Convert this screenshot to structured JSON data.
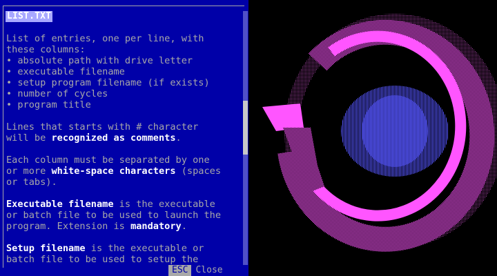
{
  "window": {
    "title": "LIST.TXT"
  },
  "help_lines": [
    [
      {
        "t": "List of entries, one per line, with"
      }
    ],
    [
      {
        "t": "these columns:"
      }
    ],
    [
      {
        "t": "• absolute path with drive letter"
      }
    ],
    [
      {
        "t": "• executable filename"
      }
    ],
    [
      {
        "t": "• setup program filename (if exists)"
      }
    ],
    [
      {
        "t": "• number of cycles"
      }
    ],
    [
      {
        "t": "• program title"
      }
    ],
    [
      {
        "t": ""
      }
    ],
    [
      {
        "t": "Lines that starts with # character"
      }
    ],
    [
      {
        "t": "will be "
      },
      {
        "t": "recognized as comments",
        "h": true
      },
      {
        "t": "."
      }
    ],
    [
      {
        "t": ""
      }
    ],
    [
      {
        "t": "Each column must be separated by one"
      }
    ],
    [
      {
        "t": "or more "
      },
      {
        "t": "white-space characters",
        "h": true
      },
      {
        "t": " (spaces"
      }
    ],
    [
      {
        "t": "or tabs)."
      }
    ],
    [
      {
        "t": ""
      }
    ],
    [
      {
        "t": "Executable filename",
        "h": true
      },
      {
        "t": " is the executable"
      }
    ],
    [
      {
        "t": "or batch file to be used to launch the"
      }
    ],
    [
      {
        "t": "program. Extension is "
      },
      {
        "t": "mandatory",
        "h": true
      },
      {
        "t": "."
      }
    ],
    [
      {
        "t": ""
      }
    ],
    [
      {
        "t": "Setup filename",
        "h": true
      },
      {
        "t": " is the executable or"
      }
    ],
    [
      {
        "t": "batch file to be used to setup the"
      }
    ]
  ],
  "bottom_bar": {
    "key": "ESC",
    "label": "Close"
  },
  "colors": {
    "panel_bg": "#0000a8",
    "text": "#a8a8a8",
    "highlight": "#ffffff",
    "logo_ring": "#ff55ff",
    "logo_disc": "#5555ff",
    "background": "#000000"
  },
  "icons": {
    "logo": "pixel-ring-logo-icon"
  }
}
